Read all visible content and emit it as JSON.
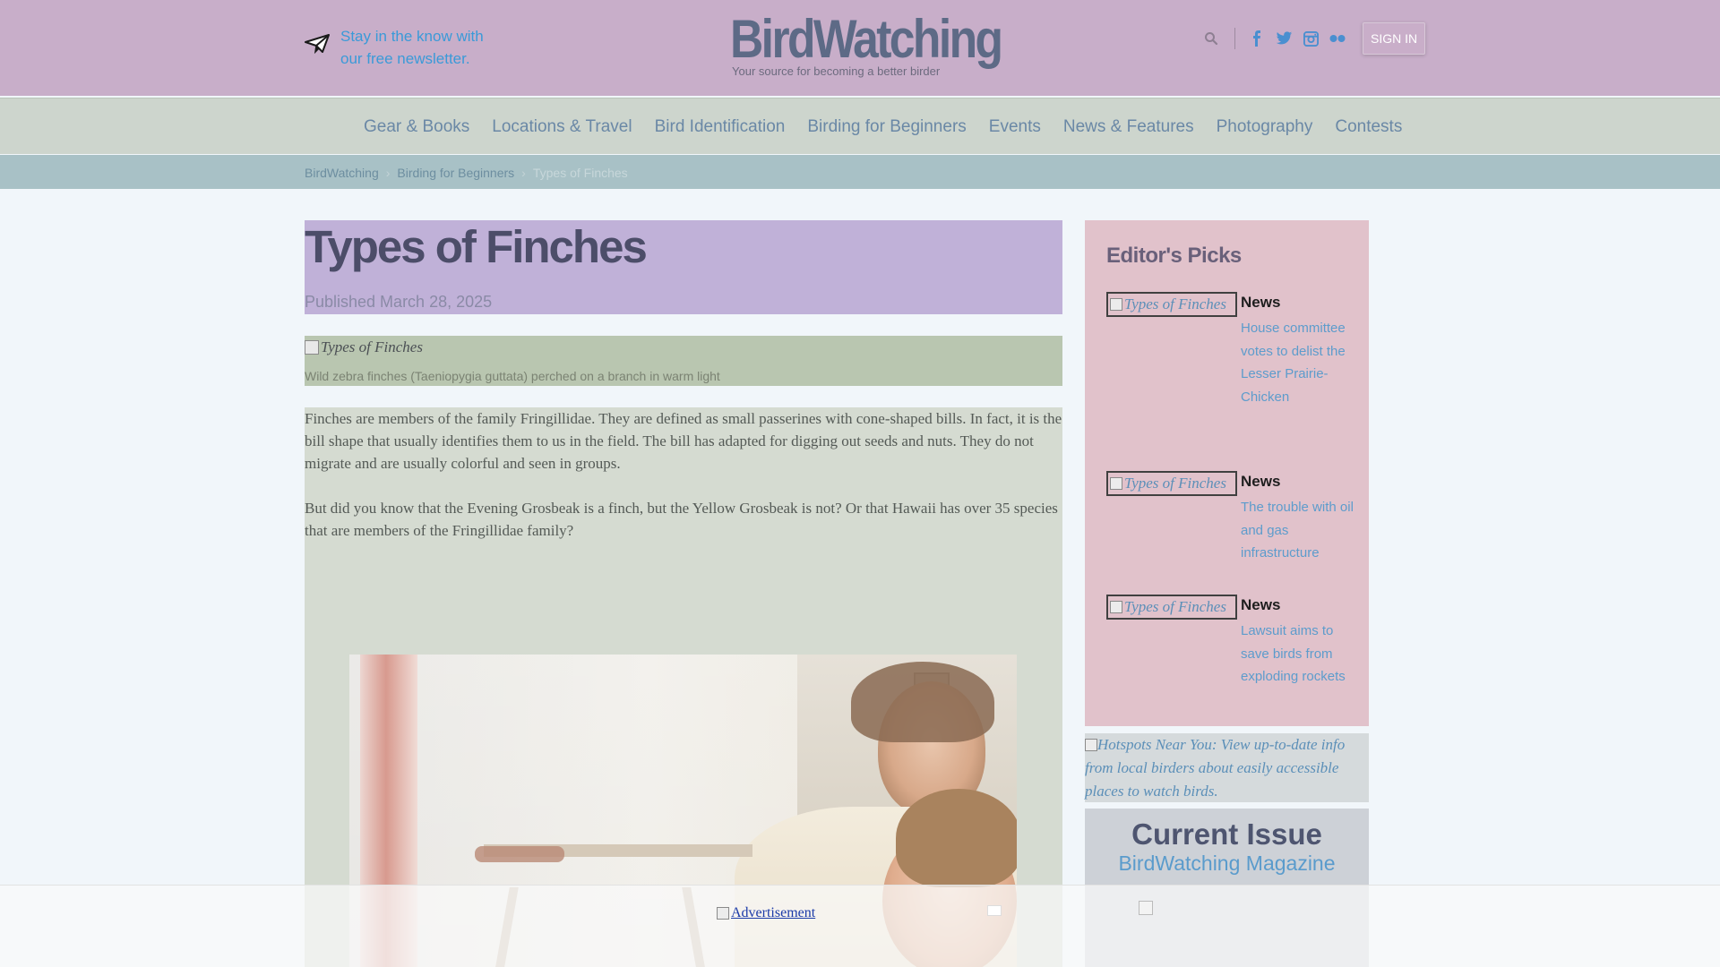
{
  "header": {
    "newsletter_line1": "Stay in the know with",
    "newsletter_line2": "our free newsletter.",
    "logo_name": "BirdWatching",
    "logo_tagline": "Your source for becoming a better birder",
    "signin_label": "SIGN IN",
    "icons": [
      "search-icon",
      "facebook-icon",
      "twitter-icon",
      "instagram-icon",
      "flickr-icon"
    ]
  },
  "nav": {
    "items": [
      "Gear & Books",
      "Locations & Travel",
      "Bird Identification",
      "Birding for Beginners",
      "Events",
      "News & Features",
      "Photography",
      "Contests"
    ]
  },
  "breadcrumb": {
    "items": [
      "BirdWatching",
      "Birding for Beginners",
      "Types of Finches"
    ],
    "separator": "›"
  },
  "article": {
    "title": "Types of Finches",
    "published": "Published March 28, 2025",
    "image_alt": "Types of Finches",
    "caption": "Wild zebra finches (Taeniopygia guttata) perched on a branch in warm light",
    "paragraphs": [
      "Finches are members of the family Fringillidae. They are defined as small passerines with cone-shaped bills. In fact, it is the bill shape that usually identifies them to us in the field. The bill has adapted for digging out seeds and nuts. They do not migrate and are usually colorful and seen in groups.",
      "But did you know that the Evening Grosbeak is a finch, but the Yellow Grosbeak is not? Or that Hawaii has over 35 species that are members of the Fringillidae family?"
    ]
  },
  "sidebar": {
    "title": "Editor's Picks",
    "picks": [
      {
        "img_alt": "Types of Finches",
        "category": "News",
        "link": "House committee votes to delist the Lesser Prairie-Chicken"
      },
      {
        "img_alt": "Types of Finches",
        "category": "News",
        "link": "The trouble with oil and gas infrastructure"
      },
      {
        "img_alt": "Types of Finches",
        "category": "News",
        "link": "Lawsuit aims to save birds from exploding rockets"
      }
    ],
    "hotspots_alt": "Hotspots Near You: View up-to-date info from local birders about easily accessible places to watch birds.",
    "current_issue_title": "Current Issue",
    "current_issue_sub": "BirdWatching Magazine"
  },
  "ad": {
    "label": "Advertisement"
  },
  "colors": {
    "header_bg": "#c8aec9",
    "nav_bg": "#cdd5cd",
    "link_blue": "#5d9ccc"
  }
}
